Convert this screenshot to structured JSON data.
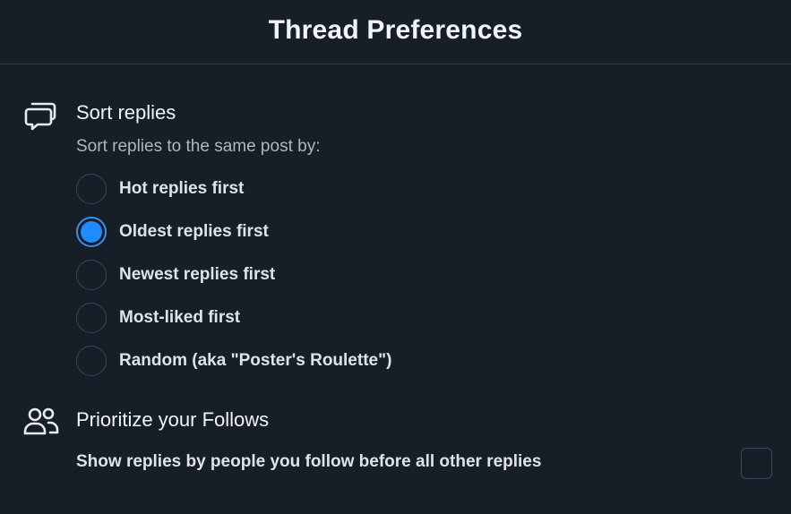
{
  "header": {
    "title": "Thread Preferences"
  },
  "sort_section": {
    "icon": "chat-bubbles-icon",
    "title": "Sort replies",
    "subtitle": "Sort replies to the same post by:",
    "options": [
      {
        "label": "Hot replies first",
        "selected": false
      },
      {
        "label": "Oldest replies first",
        "selected": true
      },
      {
        "label": "Newest replies first",
        "selected": false
      },
      {
        "label": "Most-liked first",
        "selected": false
      },
      {
        "label": "Random (aka \"Poster's Roulette\")",
        "selected": false
      }
    ]
  },
  "follows_section": {
    "icon": "people-icon",
    "title": "Prioritize your Follows",
    "description": "Show replies by people you follow before all other replies",
    "checked": false
  },
  "colors": {
    "background": "#161e27",
    "accent": "#208bfe"
  }
}
